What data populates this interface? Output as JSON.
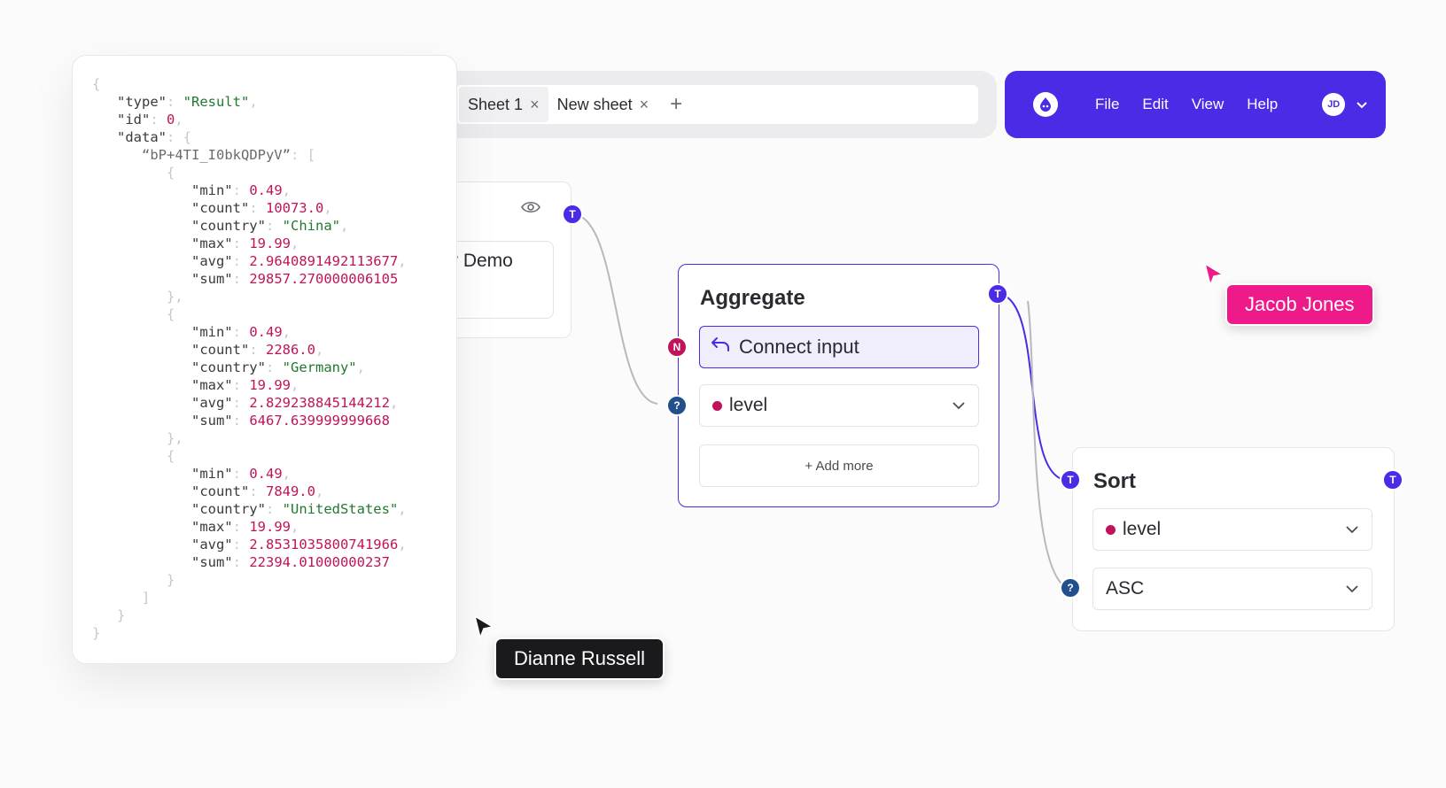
{
  "tabs": {
    "items": [
      {
        "label": "Sheet 1",
        "close": "×"
      },
      {
        "label": "New sheet",
        "close": "×"
      }
    ],
    "add_label": "+"
  },
  "menubar": {
    "menu": [
      "File",
      "Edit",
      "View",
      "Help"
    ],
    "avatar_initials": "JD",
    "accent_color": "#4b2be6"
  },
  "hidden_node": {
    "partial_text": "r Demo"
  },
  "json_panel": {
    "lines": [
      [
        [
          "p",
          "{"
        ]
      ],
      [
        [
          "p",
          "   "
        ],
        [
          "k",
          "\"type\""
        ],
        [
          "p",
          ": "
        ],
        [
          "s",
          "\"Result\""
        ],
        [
          "p",
          ","
        ]
      ],
      [
        [
          "p",
          "   "
        ],
        [
          "k",
          "\"id\""
        ],
        [
          "p",
          ": "
        ],
        [
          "n",
          "0"
        ],
        [
          "p",
          ","
        ]
      ],
      [
        [
          "p",
          "   "
        ],
        [
          "k",
          "\"data\""
        ],
        [
          "p",
          ": {"
        ]
      ],
      [
        [
          "p",
          "      "
        ],
        [
          "sg",
          "“bP+4TI_I0bkQDPyV”"
        ],
        [
          "p",
          ": ["
        ]
      ],
      [
        [
          "p",
          "         {"
        ]
      ],
      [
        [
          "p",
          "            "
        ],
        [
          "k",
          "\"min\""
        ],
        [
          "p",
          ": "
        ],
        [
          "n",
          "0.49"
        ],
        [
          "p",
          ","
        ]
      ],
      [
        [
          "p",
          "            "
        ],
        [
          "k",
          "\"count\""
        ],
        [
          "p",
          ": "
        ],
        [
          "n",
          "10073.0"
        ],
        [
          "p",
          ","
        ]
      ],
      [
        [
          "p",
          "            "
        ],
        [
          "k",
          "\"country\""
        ],
        [
          "p",
          ": "
        ],
        [
          "s",
          "\"China\""
        ],
        [
          "p",
          ","
        ]
      ],
      [
        [
          "p",
          "            "
        ],
        [
          "k",
          "\"max\""
        ],
        [
          "p",
          ": "
        ],
        [
          "n",
          "19.99"
        ],
        [
          "p",
          ","
        ]
      ],
      [
        [
          "p",
          "            "
        ],
        [
          "k",
          "\"avg\""
        ],
        [
          "p",
          ": "
        ],
        [
          "n",
          "2.9640891492113677"
        ],
        [
          "p",
          ","
        ]
      ],
      [
        [
          "p",
          "            "
        ],
        [
          "k",
          "\"sum\""
        ],
        [
          "p",
          ": "
        ],
        [
          "n",
          "29857.270000006105"
        ]
      ],
      [
        [
          "p",
          "         },"
        ]
      ],
      [
        [
          "p",
          "         {"
        ]
      ],
      [
        [
          "p",
          "            "
        ],
        [
          "k",
          "\"min\""
        ],
        [
          "p",
          ": "
        ],
        [
          "n",
          "0.49"
        ],
        [
          "p",
          ","
        ]
      ],
      [
        [
          "p",
          "            "
        ],
        [
          "k",
          "\"count\""
        ],
        [
          "p",
          ": "
        ],
        [
          "n",
          "2286.0"
        ],
        [
          "p",
          ","
        ]
      ],
      [
        [
          "p",
          "            "
        ],
        [
          "k",
          "\"country\""
        ],
        [
          "p",
          ": "
        ],
        [
          "s",
          "\"Germany\""
        ],
        [
          "p",
          ","
        ]
      ],
      [
        [
          "p",
          "            "
        ],
        [
          "k",
          "\"max\""
        ],
        [
          "p",
          ": "
        ],
        [
          "n",
          "19.99"
        ],
        [
          "p",
          ","
        ]
      ],
      [
        [
          "p",
          "            "
        ],
        [
          "k",
          "\"avg\""
        ],
        [
          "p",
          ": "
        ],
        [
          "n",
          "2.829238845144212"
        ],
        [
          "p",
          ","
        ]
      ],
      [
        [
          "p",
          "            "
        ],
        [
          "k",
          "\"sum\""
        ],
        [
          "p",
          ": "
        ],
        [
          "n",
          "6467.639999999668"
        ]
      ],
      [
        [
          "p",
          "         },"
        ]
      ],
      [
        [
          "p",
          "         {"
        ]
      ],
      [
        [
          "p",
          "            "
        ],
        [
          "k",
          "\"min\""
        ],
        [
          "p",
          ": "
        ],
        [
          "n",
          "0.49"
        ],
        [
          "p",
          ","
        ]
      ],
      [
        [
          "p",
          "            "
        ],
        [
          "k",
          "\"count\""
        ],
        [
          "p",
          ": "
        ],
        [
          "n",
          "7849.0"
        ],
        [
          "p",
          ","
        ]
      ],
      [
        [
          "p",
          "            "
        ],
        [
          "k",
          "\"country\""
        ],
        [
          "p",
          ": "
        ],
        [
          "s",
          "\"UnitedStates\""
        ],
        [
          "p",
          ","
        ]
      ],
      [
        [
          "p",
          "            "
        ],
        [
          "k",
          "\"max\""
        ],
        [
          "p",
          ": "
        ],
        [
          "n",
          "19.99"
        ],
        [
          "p",
          ","
        ]
      ],
      [
        [
          "p",
          "            "
        ],
        [
          "k",
          "\"avg\""
        ],
        [
          "p",
          ": "
        ],
        [
          "n",
          "2.8531035800741966"
        ],
        [
          "p",
          ","
        ]
      ],
      [
        [
          "p",
          "            "
        ],
        [
          "k",
          "\"sum\""
        ],
        [
          "p",
          ": "
        ],
        [
          "n",
          "22394.01000000237"
        ]
      ],
      [
        [
          "p",
          "         }"
        ]
      ],
      [
        [
          "p",
          "      ]"
        ]
      ],
      [
        [
          "p",
          "   }"
        ]
      ],
      [
        [
          "p",
          "}"
        ]
      ]
    ]
  },
  "aggregate_node": {
    "title": "Aggregate",
    "connect_input": "Connect input",
    "field_value": "level",
    "add_more": "+ Add more"
  },
  "sort_node": {
    "title": "Sort",
    "field_value": "level",
    "order_value": "ASC"
  },
  "ports": {
    "t": "T",
    "n": "N",
    "q": "?"
  },
  "collaborators": [
    {
      "name": "Dianne Russell",
      "color": "#1a1a1d"
    },
    {
      "name": "Jacob Jones",
      "color": "#ef1a8a"
    }
  ]
}
